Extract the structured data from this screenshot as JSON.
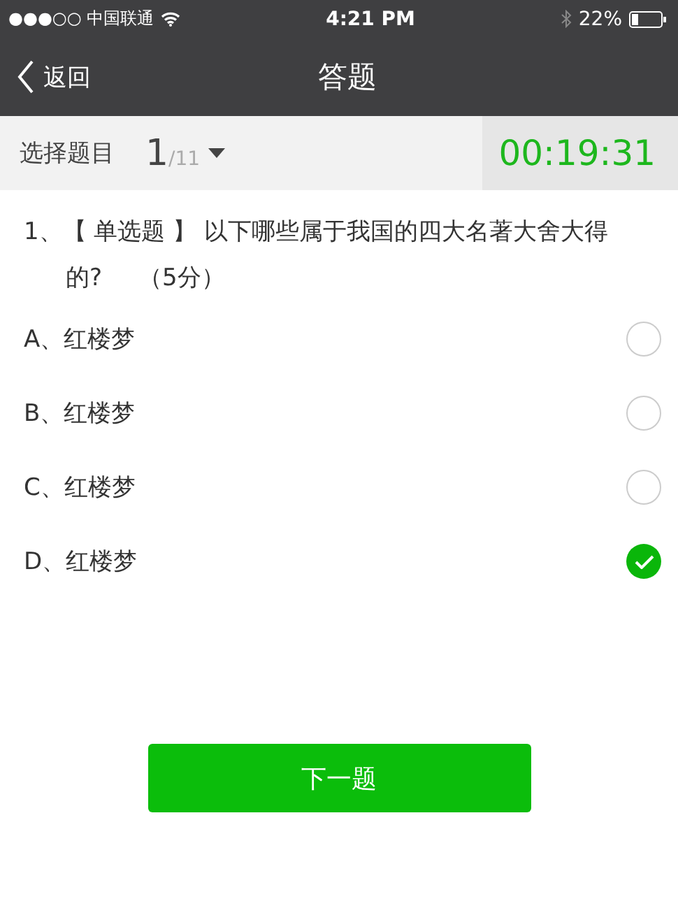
{
  "status_bar": {
    "carrier": "●●●○○ 中国联通",
    "time": "4:21 PM",
    "battery": "22%"
  },
  "nav": {
    "back": "返回",
    "title": "答题"
  },
  "selector": {
    "label": "选择题目",
    "current": "1",
    "total": "/11",
    "timer": "00:19:31"
  },
  "question": {
    "number": "1、",
    "text": "【 单选题 】 以下哪些属于我国的四大名著大舍大得的?",
    "score": "（5分）"
  },
  "options": [
    {
      "label": "A、红楼梦",
      "selected": false
    },
    {
      "label": "B、红楼梦",
      "selected": false
    },
    {
      "label": "C、红楼梦",
      "selected": false
    },
    {
      "label": "D、红楼梦",
      "selected": true
    }
  ],
  "next_button": "下一题"
}
